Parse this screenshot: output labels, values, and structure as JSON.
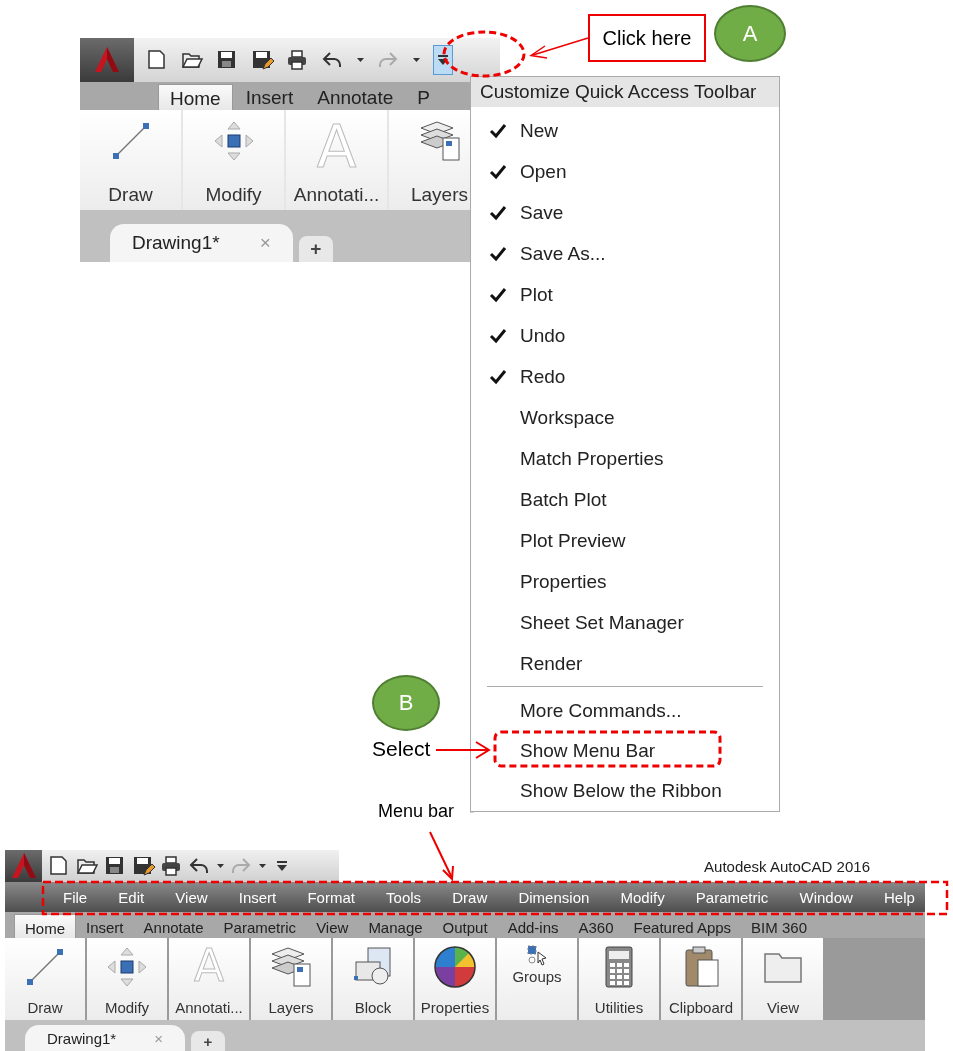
{
  "top_window": {
    "ribbon_tabs": [
      {
        "label": "Home",
        "selected": true
      },
      {
        "label": "Insert",
        "selected": false
      },
      {
        "label": "Annotate",
        "selected": false
      },
      {
        "label": "P",
        "selected": false
      }
    ],
    "panels": [
      {
        "kind": "draw",
        "label": "Draw"
      },
      {
        "kind": "modify",
        "label": "Modify"
      },
      {
        "kind": "annotate",
        "label": "Annotati...",
        "glyph": "A"
      },
      {
        "kind": "layers",
        "label": "Layers"
      }
    ],
    "document_tabs": [
      {
        "label": "Drawing1*",
        "close": "×"
      }
    ],
    "new_tab": "+"
  },
  "qat_menu": {
    "title": "Customize Quick Access Toolbar",
    "items": [
      {
        "label": "New",
        "checked": true
      },
      {
        "label": "Open",
        "checked": true
      },
      {
        "label": "Save",
        "checked": true
      },
      {
        "label": "Save As...",
        "checked": true
      },
      {
        "label": "Plot",
        "checked": true
      },
      {
        "label": "Undo",
        "checked": true
      },
      {
        "label": "Redo",
        "checked": true
      },
      {
        "label": "Workspace",
        "checked": false
      },
      {
        "label": "Match Properties",
        "checked": false
      },
      {
        "label": "Batch Plot",
        "checked": false
      },
      {
        "label": "Plot Preview",
        "checked": false
      },
      {
        "label": "Properties",
        "checked": false
      },
      {
        "label": "Sheet Set Manager",
        "checked": false
      },
      {
        "label": "Render",
        "checked": false
      }
    ],
    "commands": [
      {
        "label": "More Commands..."
      },
      {
        "label": "Show Menu Bar"
      },
      {
        "label": "Show Below the Ribbon"
      }
    ]
  },
  "annotations": {
    "callout": "Click here",
    "step_a": "A",
    "step_b": "B",
    "select_label": "Select",
    "menu_bar_label": "Menu bar"
  },
  "bottom_window": {
    "title": "Autodesk AutoCAD 2016",
    "menu_bar": [
      "File",
      "Edit",
      "View",
      "Insert",
      "Format",
      "Tools",
      "Draw",
      "Dimension",
      "Modify",
      "Parametric",
      "Window",
      "Help"
    ],
    "ribbon_tabs": [
      {
        "label": "Home",
        "selected": true
      },
      {
        "label": "Insert",
        "selected": false
      },
      {
        "label": "Annotate",
        "selected": false
      },
      {
        "label": "Parametric",
        "selected": false
      },
      {
        "label": "View",
        "selected": false
      },
      {
        "label": "Manage",
        "selected": false
      },
      {
        "label": "Output",
        "selected": false
      },
      {
        "label": "Add-ins",
        "selected": false
      },
      {
        "label": "A360",
        "selected": false
      },
      {
        "label": "Featured Apps",
        "selected": false
      },
      {
        "label": "BIM 360",
        "selected": false
      }
    ],
    "panels": [
      {
        "kind": "draw",
        "label": "Draw"
      },
      {
        "kind": "modify",
        "label": "Modify"
      },
      {
        "kind": "annotate",
        "label": "Annotati...",
        "glyph": "A"
      },
      {
        "kind": "layers",
        "label": "Layers"
      },
      {
        "kind": "block",
        "label": "Block"
      },
      {
        "kind": "properties",
        "label": "Properties"
      },
      {
        "kind": "groups",
        "label": "Groups"
      },
      {
        "kind": "utilities",
        "label": "Utilities"
      },
      {
        "kind": "clipboard",
        "label": "Clipboard"
      },
      {
        "kind": "view",
        "label": "View"
      }
    ],
    "document_tabs": [
      {
        "label": "Drawing1*",
        "close": "×"
      }
    ],
    "new_tab": "+"
  }
}
